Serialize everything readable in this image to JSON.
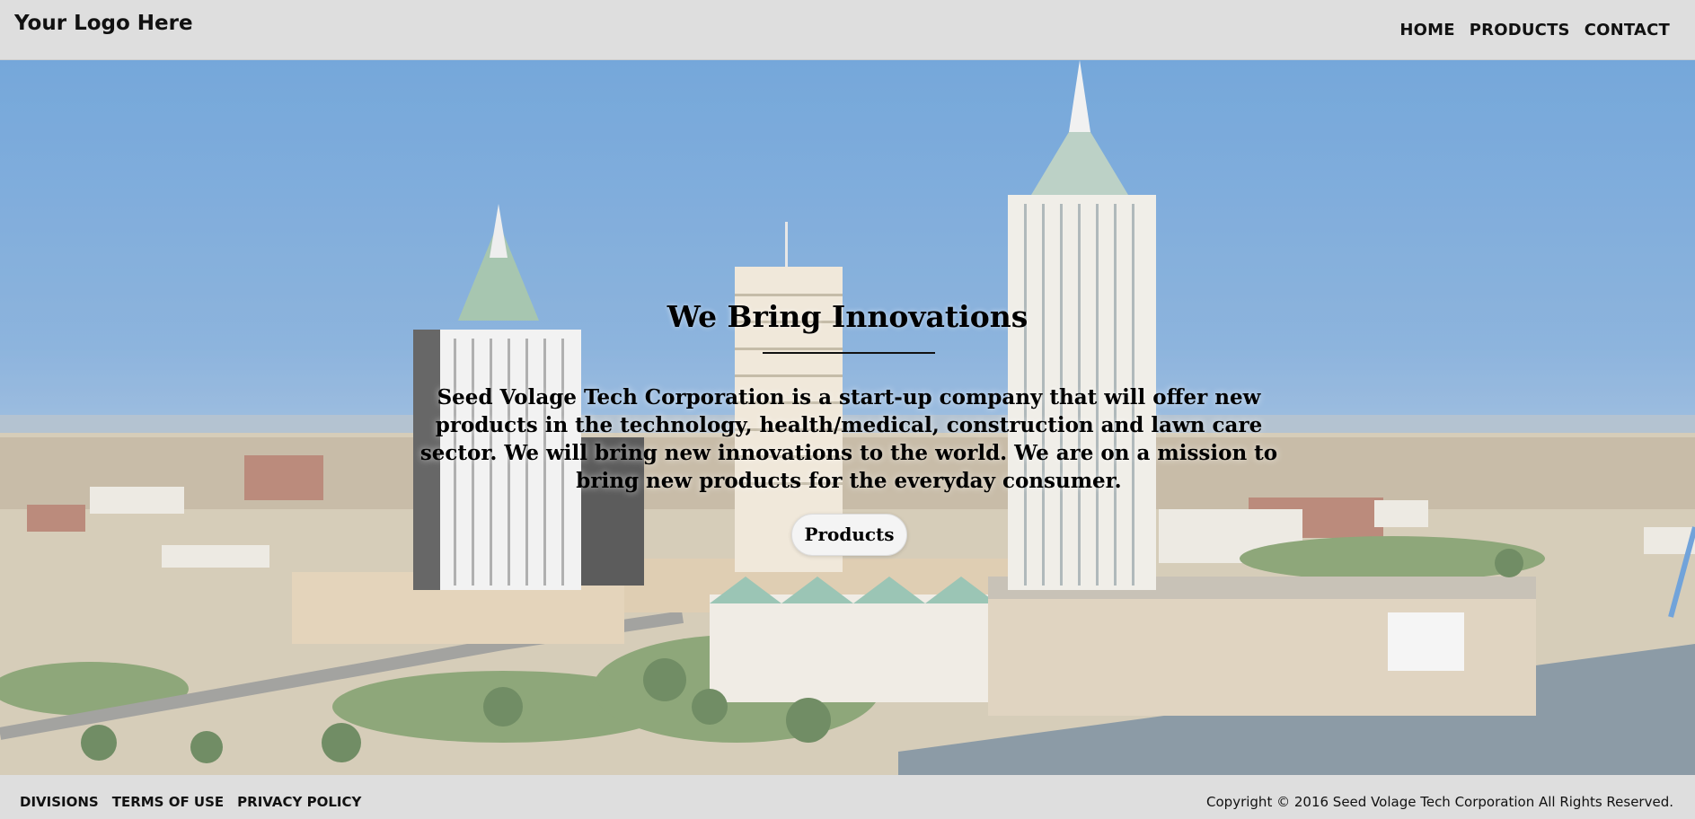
{
  "header": {
    "logo": "Your Logo Here",
    "nav": [
      "HOME",
      "PRODUCTS",
      "CONTACT"
    ]
  },
  "hero": {
    "title": "We Bring Innovations",
    "text": "Seed Volage Tech Corporation is a start-up company that will offer new products in the technology, health/medical, construction and lawn care sector. We will bring new innovations to the world. We are on a mission to bring new products for the everyday consumer.",
    "button": "Products",
    "background_image": "city-skyline-aerial"
  },
  "footer": {
    "links": [
      "DIVISIONS",
      "TERMS OF USE",
      "PRIVACY POLICY"
    ],
    "copyright": "Copyright © 2016 Seed Volage Tech Corporation All Rights Reserved."
  },
  "colors": {
    "header_bg": "#dedede",
    "footer_bg": "#dedede",
    "sky": "#4f8fd0",
    "text": "#000000"
  }
}
